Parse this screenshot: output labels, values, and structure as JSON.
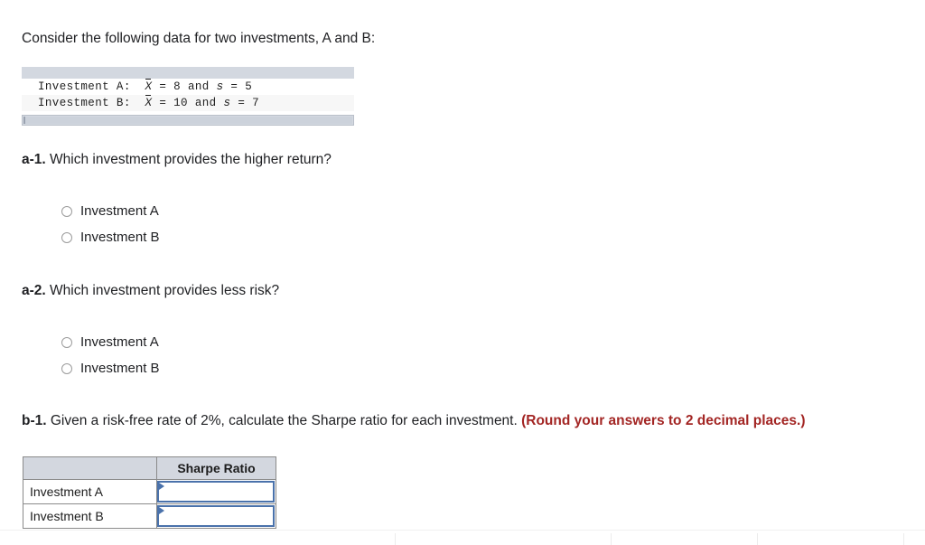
{
  "intro": {
    "text": "Consider the following data for two investments, A and B:"
  },
  "data_panel": {
    "rows": [
      {
        "label": "Investment A:",
        "mean_symbol": "X",
        "mean_eq": "=",
        "mean_value": "8",
        "conjunction": "and",
        "sd_symbol": "s",
        "sd_eq": "=",
        "sd_value": "5"
      },
      {
        "label": "Investment B:",
        "mean_symbol": "X",
        "mean_eq": "=",
        "mean_value": "10",
        "conjunction": "and",
        "sd_symbol": "s",
        "sd_eq": "=",
        "sd_value": "7"
      }
    ]
  },
  "question_a1": {
    "label": "a-1.",
    "text": "Which investment provides the higher return?",
    "options": [
      {
        "label": "Investment A",
        "selected": false
      },
      {
        "label": "Investment B",
        "selected": false
      }
    ]
  },
  "question_a2": {
    "label": "a-2.",
    "text": "Which investment provides less risk?",
    "options": [
      {
        "label": "Investment A",
        "selected": false
      },
      {
        "label": "Investment B",
        "selected": false
      }
    ]
  },
  "question_b1": {
    "label": "b-1.",
    "text": "Given a risk-free rate of 2%, calculate the Sharpe ratio for each investment.",
    "note": "(Round your answers to 2 decimal places.)",
    "note_color": "#a32624",
    "answer_table": {
      "headers": [
        "",
        "Sharpe Ratio"
      ],
      "rows": [
        {
          "label": "Investment A",
          "value": "",
          "placeholder": ""
        },
        {
          "label": "Investment B",
          "value": "",
          "placeholder": ""
        }
      ]
    }
  },
  "theme": {
    "header_fill": "#d3d8e0",
    "input_border": "#4a72ab",
    "table_border": "#8a8a8a",
    "alt_row_fill": "#f7f7f7"
  }
}
